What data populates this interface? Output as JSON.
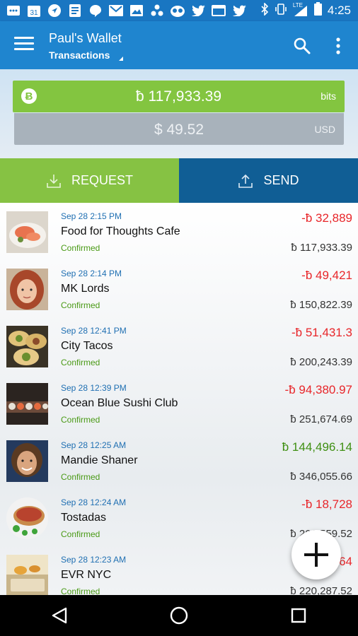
{
  "status_bar": {
    "time": "4:25",
    "network": "LTE",
    "left_icons": [
      "mail-icon",
      "calendar-icon",
      "navigation-icon",
      "notes-icon",
      "chat-icon",
      "gmail-icon",
      "image-icon",
      "dots-icon",
      "owl-icon",
      "twitter-icon",
      "window-icon",
      "twitter-icon"
    ],
    "calendar_day": "31"
  },
  "app_bar": {
    "title": "Paul's Wallet",
    "subtitle": "Transactions"
  },
  "balance": {
    "btc_amount": "ƀ 117,933.39",
    "btc_unit": "bits",
    "btc_badge": "Ƀ",
    "usd_amount": "$ 49.52",
    "usd_unit": "USD"
  },
  "actions": {
    "request_label": "REQUEST",
    "send_label": "SEND"
  },
  "transactions": [
    {
      "date": "Sep 28 2:15 PM",
      "name": "Food for Thoughts Cafe",
      "status": "Confirmed",
      "amount": "-ƀ  32,889",
      "running": "ƀ  117,933.39",
      "positive": false
    },
    {
      "date": "Sep 28 2:14 PM",
      "name": "MK Lords",
      "status": "Confirmed",
      "amount": "-ƀ  49,421",
      "running": "ƀ  150,822.39",
      "positive": false
    },
    {
      "date": "Sep 28 12:41 PM",
      "name": "City Tacos",
      "status": "Confirmed",
      "amount": "-ƀ  51,431.3",
      "running": "ƀ  200,243.39",
      "positive": false
    },
    {
      "date": "Sep 28 12:39 PM",
      "name": "Ocean Blue Sushi Club",
      "status": "Confirmed",
      "amount": "-ƀ  94,380.97",
      "running": "ƀ  251,674.69",
      "positive": false
    },
    {
      "date": "Sep 28 12:25 AM",
      "name": "Mandie Shaner",
      "status": "Confirmed",
      "amount": "ƀ  144,496.14",
      "running": "ƀ  346,055.66",
      "positive": true
    },
    {
      "date": "Sep 28 12:24 AM",
      "name": "Tostadas",
      "status": "Confirmed",
      "amount": "-ƀ  18,728",
      "running": "ƀ  201,559.52",
      "positive": false
    },
    {
      "date": "Sep 28 12:23 AM",
      "name": "EVR NYC",
      "status": "Confirmed",
      "amount": "-ƀ  19,664",
      "running": "ƀ  220,287.52",
      "positive": false
    }
  ],
  "colors": {
    "app_bar": "#1f85cf",
    "request_green": "#86c243",
    "send_blue": "#105e95",
    "negative": "#e8262a",
    "positive": "#3f8f12"
  }
}
